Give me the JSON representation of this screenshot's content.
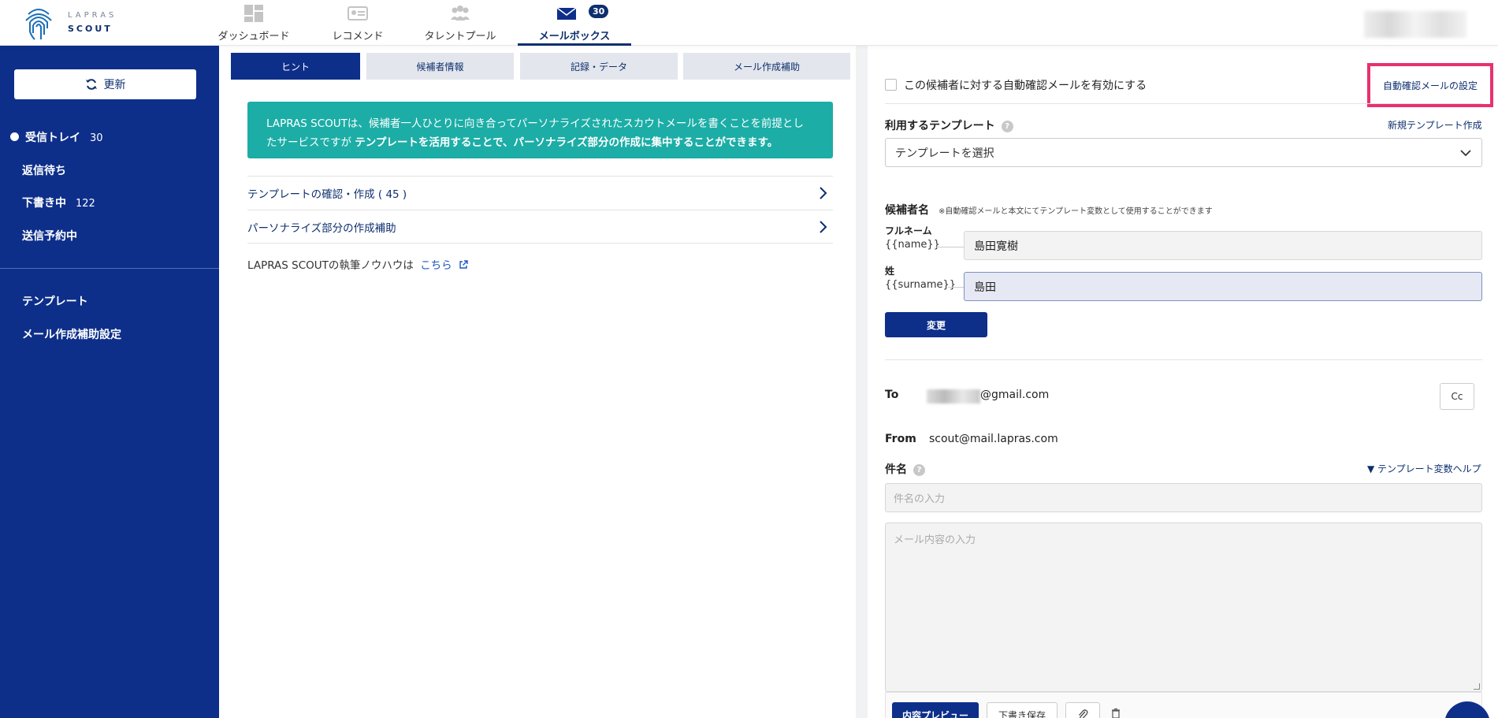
{
  "header": {
    "logo_top": "LAPRAS",
    "logo_bottom": "SCOUT",
    "nav": [
      {
        "label": "ダッシュボード",
        "icon": "dashboard-icon"
      },
      {
        "label": "レコメンド",
        "icon": "recommend-icon"
      },
      {
        "label": "タレントプール",
        "icon": "talent-pool-icon"
      },
      {
        "label": "メールボックス",
        "icon": "mail-icon",
        "badge": "30"
      }
    ]
  },
  "sidebar": {
    "refresh_label": "更新",
    "items": [
      {
        "label": "受信トレイ",
        "count": "30"
      },
      {
        "label": "返信待ち"
      },
      {
        "label": "下書き中",
        "count": "122"
      },
      {
        "label": "送信予約中"
      },
      {
        "label": "テンプレート"
      },
      {
        "label": "メール作成補助設定"
      }
    ]
  },
  "middle": {
    "tabs": [
      {
        "label": "ヒント"
      },
      {
        "label": "候補者情報"
      },
      {
        "label": "記録・データ"
      },
      {
        "label": "メール作成補助"
      }
    ],
    "hint_text_1": "LAPRAS SCOUTは、候補者一人ひとりに向き合ってパーソナライズされたスカウトメールを書くことを前提としたサービスですが",
    "hint_text_bold": "テンプレートを活用することで、パーソナライズ部分の作成に集中することができます。",
    "links": [
      {
        "label": "テンプレートの確認・作成 ( 45 )"
      },
      {
        "label": "パーソナライズ部分の作成補助"
      }
    ],
    "knowhow_text": "LAPRAS SCOUTの執筆ノウハウは",
    "knowhow_link": "こちら"
  },
  "right": {
    "auto_confirm_label": "この候補者に対する自動確認メールを有効にする",
    "auto_confirm_settings": "自動確認メールの設定",
    "template_label": "利用するテンプレート",
    "new_template_link": "新規テンプレート作成",
    "template_select": "テンプレートを選択",
    "candidate_label": "候補者名",
    "candidate_note": "※自動確認メールと本文にてテンプレート変数として使用することができます",
    "fullname_label": "フルネーム",
    "fullname_var": "{{name}}",
    "fullname_value": "島田寛樹",
    "surname_label": "姓",
    "surname_var": "{{surname}}",
    "surname_value": "島田",
    "change_button": "変更",
    "to_label": "To",
    "to_email": "@gmail.com",
    "cc_label": "Cc",
    "from_label": "From",
    "from_email": "scout@mail.lapras.com",
    "subject_label": "件名",
    "template_var_help": "▼ テンプレート変数ヘルプ",
    "subject_placeholder": "件名の入力",
    "body_placeholder": "メール内容の入力",
    "preview_button": "内容プレビュー",
    "draft_button": "下書き保存"
  },
  "colors": {
    "brand_navy": "#0d2f8a",
    "hint_teal": "#1cada6",
    "highlight_pink": "#e8316e"
  }
}
